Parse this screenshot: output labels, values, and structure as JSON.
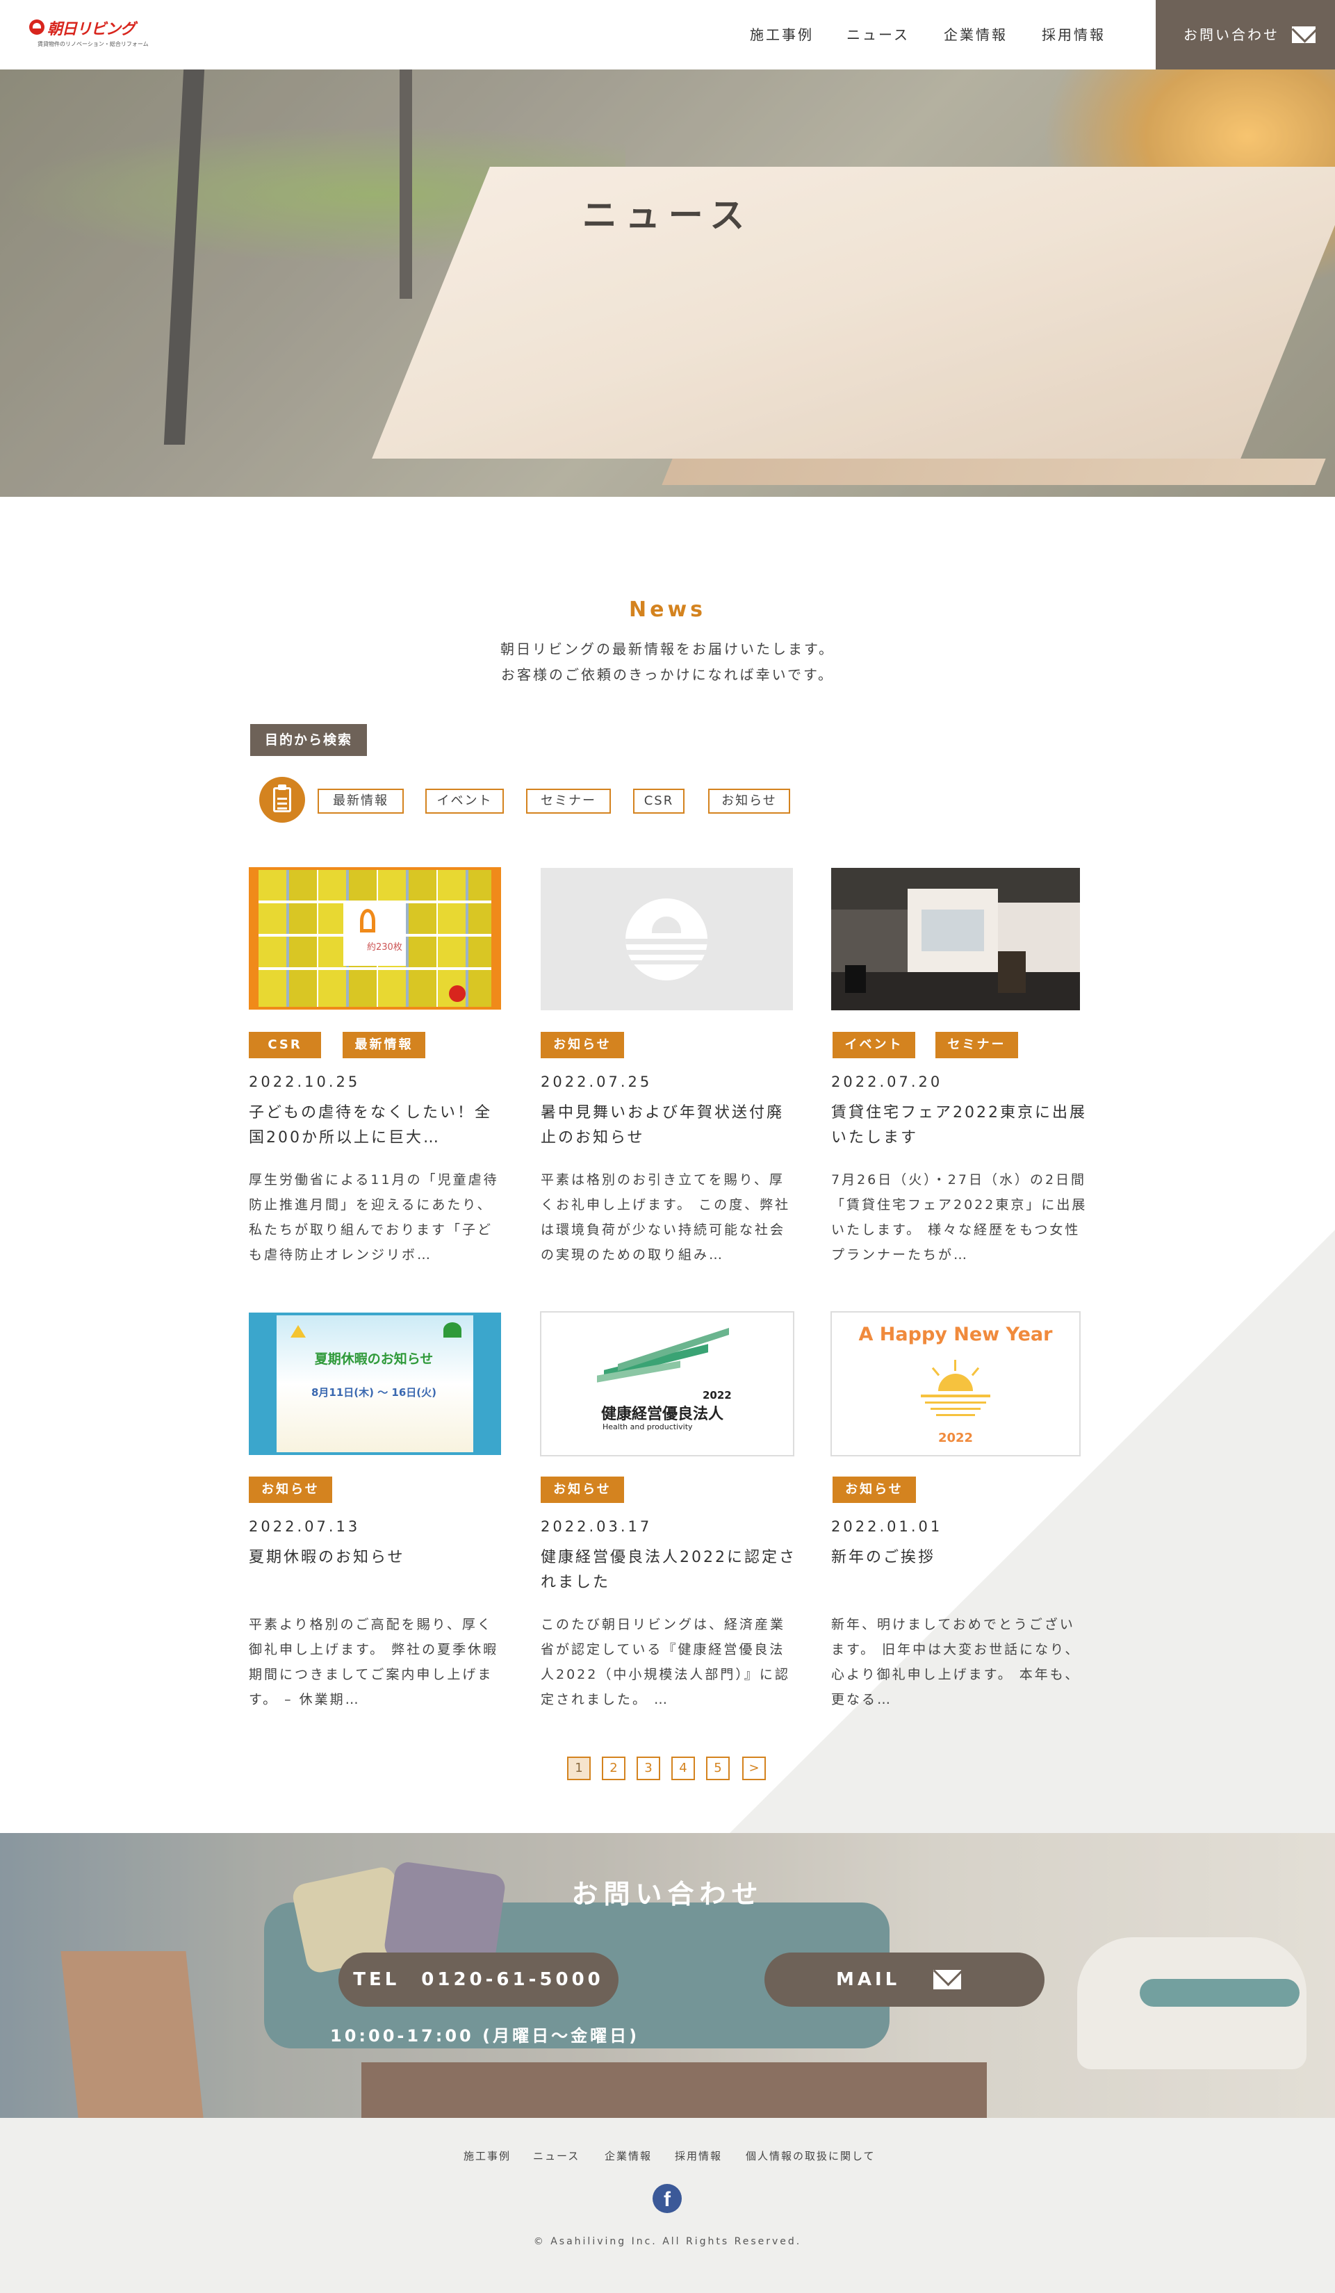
{
  "header": {
    "logo_text": "朝日リビング",
    "logo_sub": "賃貸物件のリノベーション・総合リフォーム",
    "nav": [
      "施工事例",
      "ニュース",
      "企業情報",
      "採用情報"
    ],
    "contact_label": "お問い合わせ"
  },
  "hero": {
    "title": "ニュース"
  },
  "intro": {
    "en_title": "News",
    "line1": "朝日リビングの最新情報をお届けいたします。",
    "line2": "お客様のご依頼のきっかけになれば幸いです。"
  },
  "filter": {
    "label": "目的から検索",
    "tags": [
      "最新情報",
      "イベント",
      "セミナー",
      "CSR",
      "お知らせ"
    ]
  },
  "posts": [
    {
      "categories": [
        "CSR",
        "最新情報"
      ],
      "date": "2022.10.25",
      "title": "子どもの虐待をなくしたい！全国200か所以上に巨大…",
      "excerpt": "厚生労働省による11月の「児童虐待防止推進月間」を迎えるにあたり、私たちが取り組んでおります「子ども虐待防止オレンジリボ…",
      "thumb_text": "約230枚"
    },
    {
      "categories": [
        "お知らせ"
      ],
      "date": "2022.07.25",
      "title": "暑中見舞いおよび年賀状送付廃止のお知らせ",
      "excerpt": "平素は格別のお引き立てを賜り、厚くお礼申し上げます。 この度、弊社は環境負荷が少ない持続可能な社会の実現のための取り組み…"
    },
    {
      "categories": [
        "イベント",
        "セミナー"
      ],
      "date": "2022.07.20",
      "title": "賃貸住宅フェア2022東京に出展いたします",
      "excerpt": "7月26日（火）・27日（水）の2日間「賃貸住宅フェア2022東京」に出展いたします。 様々な経歴をもつ女性プランナーたちが…"
    },
    {
      "categories": [
        "お知らせ"
      ],
      "date": "2022.07.13",
      "title": "夏期休暇のお知らせ",
      "excerpt": "平素より格別のご高配を賜り、厚く御礼申し上げます。 弊社の夏季休暇期間につきましてご案内申し上げます。 – 休業期…",
      "thumb_title": "夏期休暇のお知らせ",
      "thumb_dates": "8月11日(木) 〜 16日(火)"
    },
    {
      "categories": [
        "お知らせ"
      ],
      "date": "2022.03.17",
      "title": "健康経営優良法人2022に認定されました",
      "excerpt": "このたび朝日リビングは、経済産業省が認定している『健康経営優良法人2022（中小規模法人部門）』に認定されました。 …",
      "thumb_year": "2022",
      "thumb_title": "健康経営優良法人",
      "thumb_en": "Health and productivity"
    },
    {
      "categories": [
        "お知らせ"
      ],
      "date": "2022.01.01",
      "title": "新年のご挨拶",
      "excerpt": "新年、明けましておめでとうございます。 旧年中は大変お世話になり、心より御礼申し上げます。 本年も、更なる…",
      "thumb_title": "A Happy New Year",
      "thumb_year": "2022"
    }
  ],
  "pagination": {
    "pages": [
      "1",
      "2",
      "3",
      "4",
      "5"
    ],
    "next": ">",
    "current": 1
  },
  "contact": {
    "title": "お問い合わせ",
    "tel": "TEL　0120-61-5000",
    "mail": "MAIL",
    "hours": "10:00-17:00 (月曜日〜金曜日)"
  },
  "footer": {
    "nav": [
      "施工事例",
      "ニュース",
      "企業情報",
      "採用情報",
      "個人情報の取扱に関して"
    ],
    "social_icon": "facebook-icon",
    "copyright": "© Asahiliving Inc. All Rights Reserved."
  },
  "colors": {
    "accent": "#d4831f",
    "dark": "#6e6258",
    "footer_bg": "#efefed"
  }
}
